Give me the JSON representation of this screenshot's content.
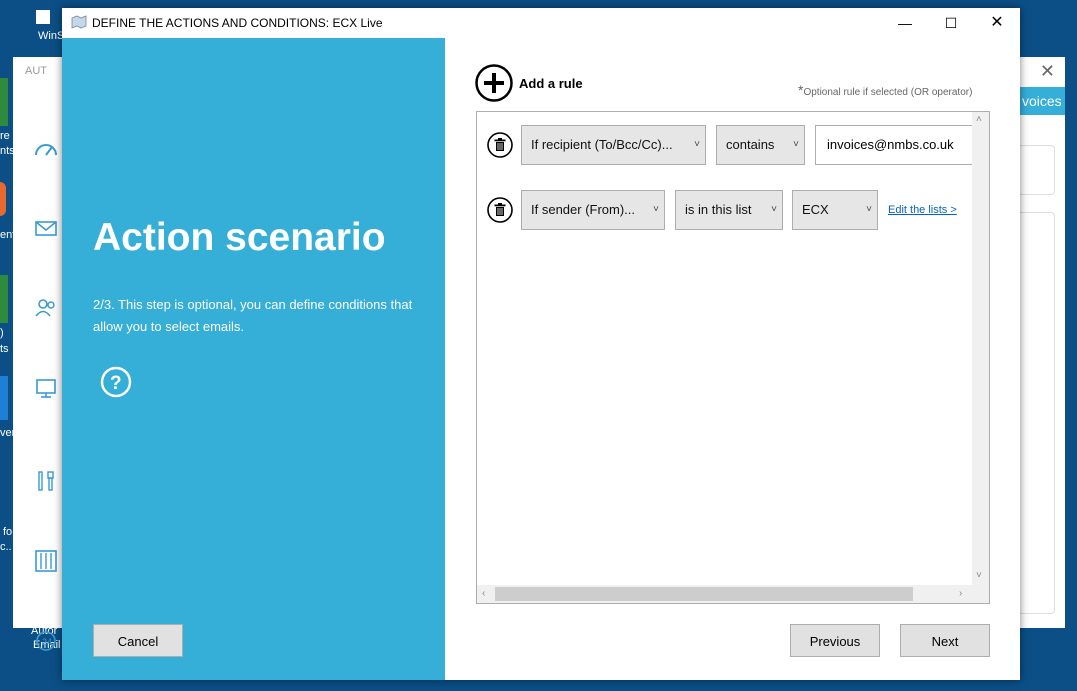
{
  "desktop": {
    "labels": [
      "e",
      "WinS",
      "re",
      "nts",
      "ent",
      ")",
      "ts",
      "ver",
      "fo",
      "c..",
      "Autor",
      "Email"
    ],
    "accent_green": "#2e8b3e",
    "accent_orange": "#e8692d",
    "accent_blue": "#1e7fd6"
  },
  "background_app": {
    "title": "AUT",
    "banner_text": "voices",
    "sidebar_icons": [
      "speedometer-icon",
      "envelope-icon",
      "users-icon",
      "monitor-icon",
      "tools-icon",
      "sliders-icon",
      "support-24-icon"
    ]
  },
  "dialog": {
    "title": "DEFINE THE ACTIONS AND CONDITIONS: ECX Live",
    "left": {
      "heading": "Action scenario",
      "description": "2/3. This step is optional, you can define conditions that allow you to select emails.",
      "cancel_label": "Cancel"
    },
    "right": {
      "add_rule_label": "Add a rule",
      "note_star": "*",
      "note": "Optional rule if selected (OR operator)",
      "rules": [
        {
          "field": "If recipient (To/Bcc/Cc)...",
          "operator": "contains",
          "value": "invoices@nmbs.co.uk"
        },
        {
          "field": "If sender (From)...",
          "operator": "is in this list",
          "value": "ECX",
          "link": "Edit the lists >"
        }
      ],
      "previous_label": "Previous",
      "next_label": "Next"
    },
    "colors": {
      "panel": "#35aed8",
      "button_bg": "#e1e1e1",
      "link": "#0563c1"
    }
  }
}
